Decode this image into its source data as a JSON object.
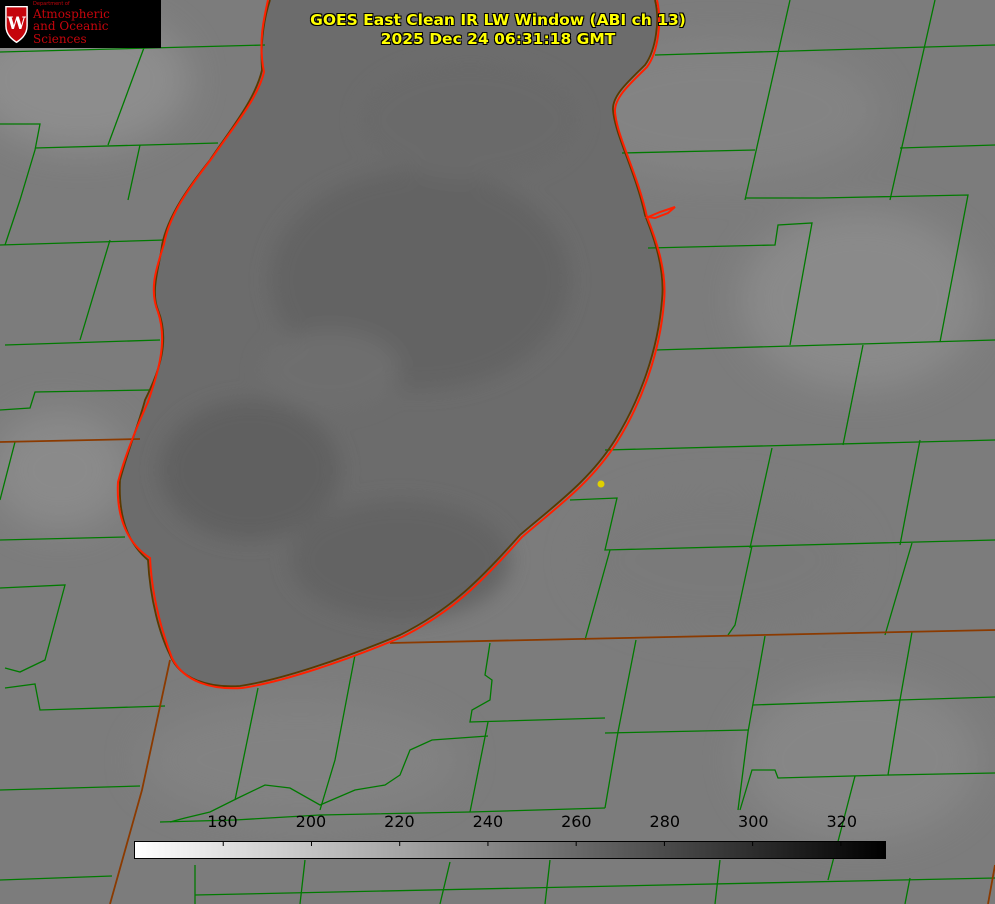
{
  "title": {
    "line1": "GOES East Clean IR LW Window (ABI ch 13)",
    "line2": "2025 Dec 24 06:31:18 GMT",
    "color": "#ffff00"
  },
  "logo": {
    "department": "Department of",
    "line1": "Atmospheric",
    "line2": "and Oceanic Sciences",
    "crest_letter": "W",
    "brand_color": "#c5050c"
  },
  "colorbar": {
    "min": 160,
    "max": 330,
    "ticks": [
      "180",
      "200",
      "220",
      "240",
      "260",
      "280",
      "300",
      "320"
    ],
    "low_color": "#ffffff",
    "high_color": "#000000"
  },
  "map": {
    "lake_color": "#6a6a6a",
    "land_color": "#7c7c7c",
    "county_line_color": "#007a00",
    "state_line_color": "#8b3a00",
    "shoreline_color": "#ff2000",
    "marker_color": "#e0d000"
  }
}
